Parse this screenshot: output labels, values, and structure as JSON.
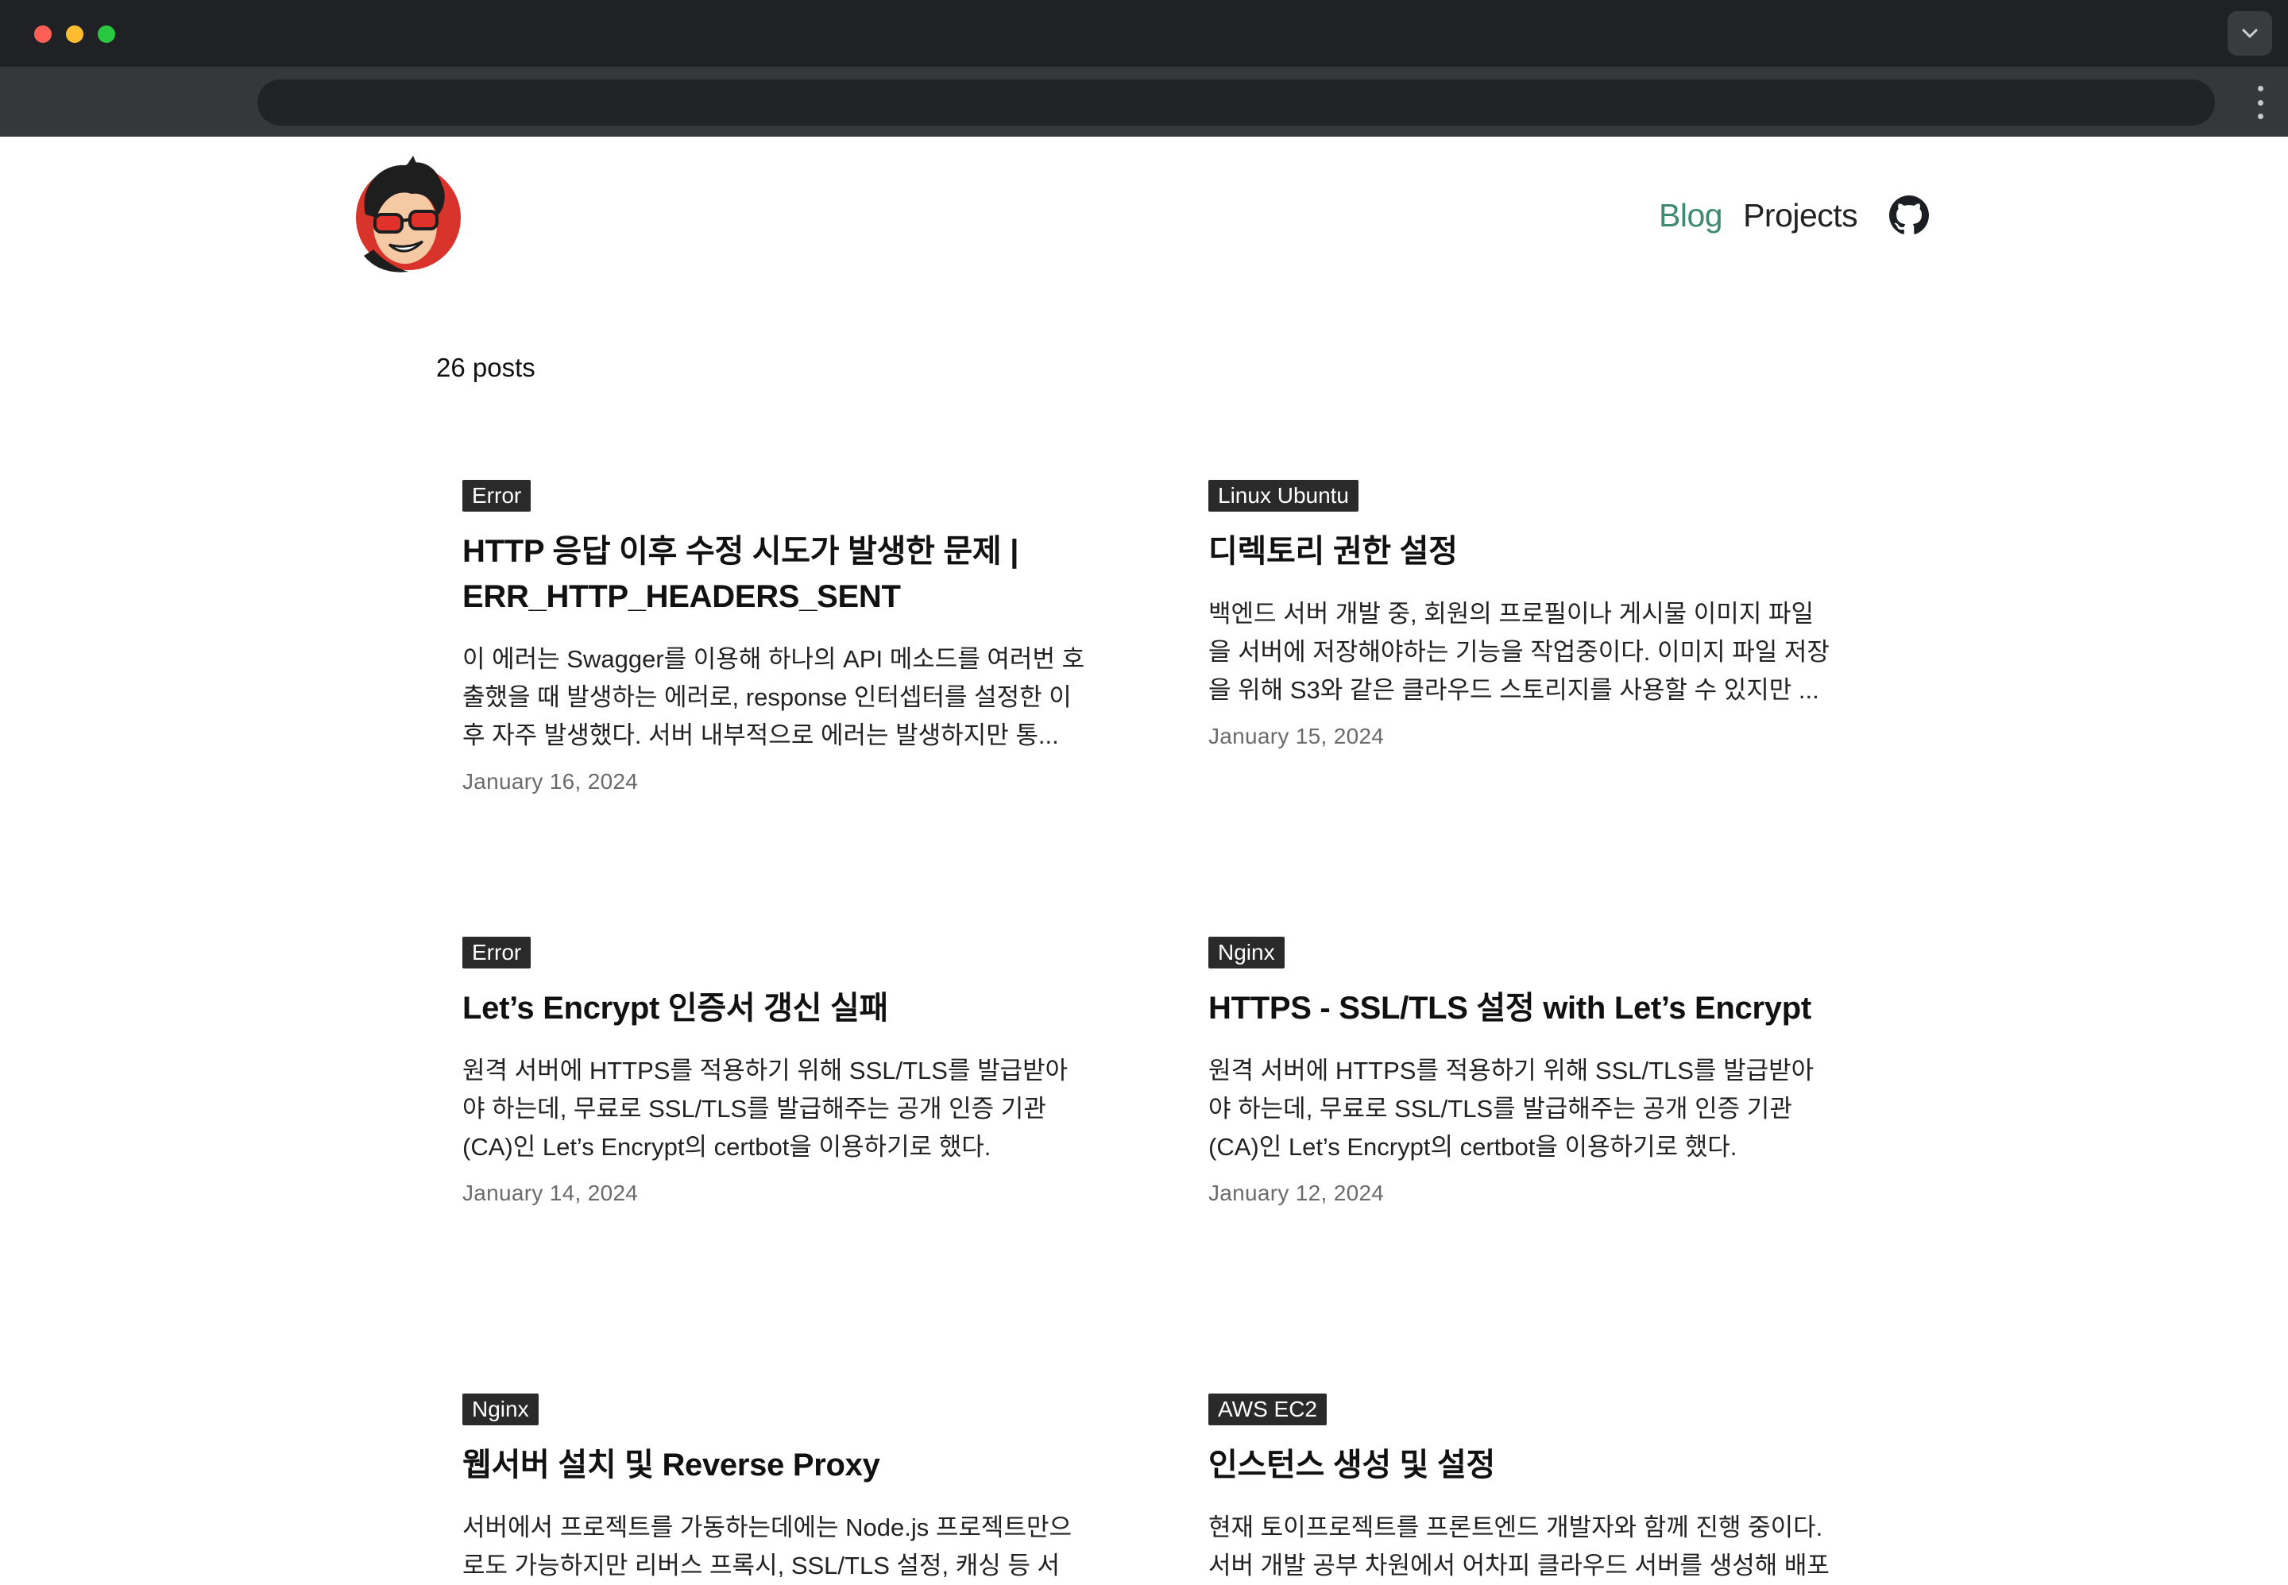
{
  "nav": {
    "blog": "Blog",
    "projects": "Projects",
    "github_icon": "github-icon"
  },
  "post_count": "26 posts",
  "posts": [
    {
      "tag": "Error",
      "title": "HTTP 응답 이후 수정 시도가 발생한 문제 | ERR_HTTP_HEADERS_SENT",
      "excerpt": "이 에러는 Swagger를 이용해 하나의 API 메소드를 여러번 호출했을 때 발생하는 에러로, response 인터셉터를 설정한 이후 자주 발생했다. 서버 내부적으로 에러는 발생하지만 통...",
      "date": "January 16, 2024"
    },
    {
      "tag": "Linux Ubuntu",
      "title": "디렉토리 권한 설정",
      "excerpt": "백엔드 서버 개발 중, 회원의 프로필이나 게시물 이미지 파일을 서버에 저장해야하는 기능을 작업중이다. 이미지 파일 저장을 위해 S3와 같은 클라우드 스토리지를 사용할 수 있지만 ...",
      "date": "January 15, 2024"
    },
    {
      "tag": "Error",
      "title": "Let’s Encrypt 인증서 갱신 실패",
      "excerpt": "원격 서버에 HTTPS를 적용하기 위해 SSL/TLS를 발급받아야 하는데, 무료로 SSL/TLS를 발급해주는 공개 인증 기관(CA)인 Let’s Encrypt의 certbot을 이용하기로 했다.",
      "date": "January 14, 2024"
    },
    {
      "tag": "Nginx",
      "title": "HTTPS - SSL/TLS 설정 with Let’s Encrypt",
      "excerpt": "원격 서버에 HTTPS를 적용하기 위해 SSL/TLS를 발급받아야 하는데, 무료로 SSL/TLS를 발급해주는 공개 인증 기관(CA)인 Let’s Encrypt의 certbot을 이용하기로 했다.",
      "date": "January 12, 2024"
    },
    {
      "tag": "Nginx",
      "title": "웹서버 설치 및 Reverse Proxy",
      "excerpt": "서버에서 프로젝트를 가동하는데에는 Node.js 프로젝트만으로도 가능하지만 리버스 프록시, SSL/TLS 설정, 캐싱 등 서",
      "date": ""
    },
    {
      "tag": "AWS EC2",
      "title": "인스턴스 생성 및 설정",
      "excerpt": "현재 토이프로젝트를 프론트엔드 개발자와 함께 진행 중이다. 서버 개발 공부 차원에서 어차피 클라우드 서버를 생성해 배포",
      "date": ""
    }
  ],
  "colors": {
    "accent": "#3d8a6e",
    "tag_bg": "#2a2a2a",
    "chrome_bg": "#202124"
  }
}
